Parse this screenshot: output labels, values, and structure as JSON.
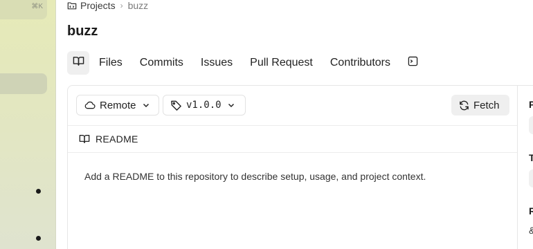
{
  "sidebar": {
    "shortcut_hint": "⌘K"
  },
  "breadcrumb": {
    "root": "Projects",
    "separator": "›",
    "current": "buzz"
  },
  "page": {
    "title": "buzz"
  },
  "tabs": [
    {
      "label": "Files"
    },
    {
      "label": "Commits"
    },
    {
      "label": "Issues"
    },
    {
      "label": "Pull Request"
    },
    {
      "label": "Contributors"
    }
  ],
  "toolbar": {
    "remote_label": "Remote",
    "tag_label": "v1.0.0",
    "fetch_label": "Fetch"
  },
  "readme": {
    "header": "README",
    "body": "Add a README to this repository to describe setup, usage, and project context."
  },
  "right_panel": {
    "letters": [
      "P",
      "T",
      "R"
    ],
    "glyph": "&"
  }
}
